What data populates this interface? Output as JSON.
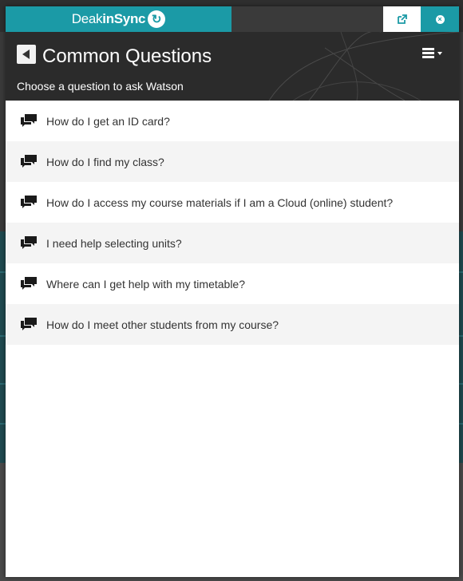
{
  "brand": {
    "name_part1": "Deak",
    "name_part2": "inSync",
    "logo_icon": "sync-icon"
  },
  "toolbar": {
    "popout_icon": "external-link-icon",
    "close_icon": "close-icon"
  },
  "header": {
    "title": "Common Questions",
    "subtitle": "Choose a question to ask Watson",
    "back_icon": "back-arrow-icon",
    "menu_icon": "hamburger-menu-icon"
  },
  "questions": [
    {
      "text": "How do I get an ID card?",
      "icon": "chat-bubbles-icon"
    },
    {
      "text": "How do I find my class?",
      "icon": "chat-bubbles-icon"
    },
    {
      "text": "How do I access my course materials if I am a Cloud (online) student?",
      "icon": "chat-bubbles-icon"
    },
    {
      "text": "I need help selecting units?",
      "icon": "chat-bubbles-icon"
    },
    {
      "text": "Where can I get help with my timetable?",
      "icon": "chat-bubbles-icon"
    },
    {
      "text": "How do I meet other students from my course?",
      "icon": "chat-bubbles-icon"
    }
  ],
  "colors": {
    "brand_teal": "#1b9aa6",
    "header_dark": "#2b2b2b"
  }
}
